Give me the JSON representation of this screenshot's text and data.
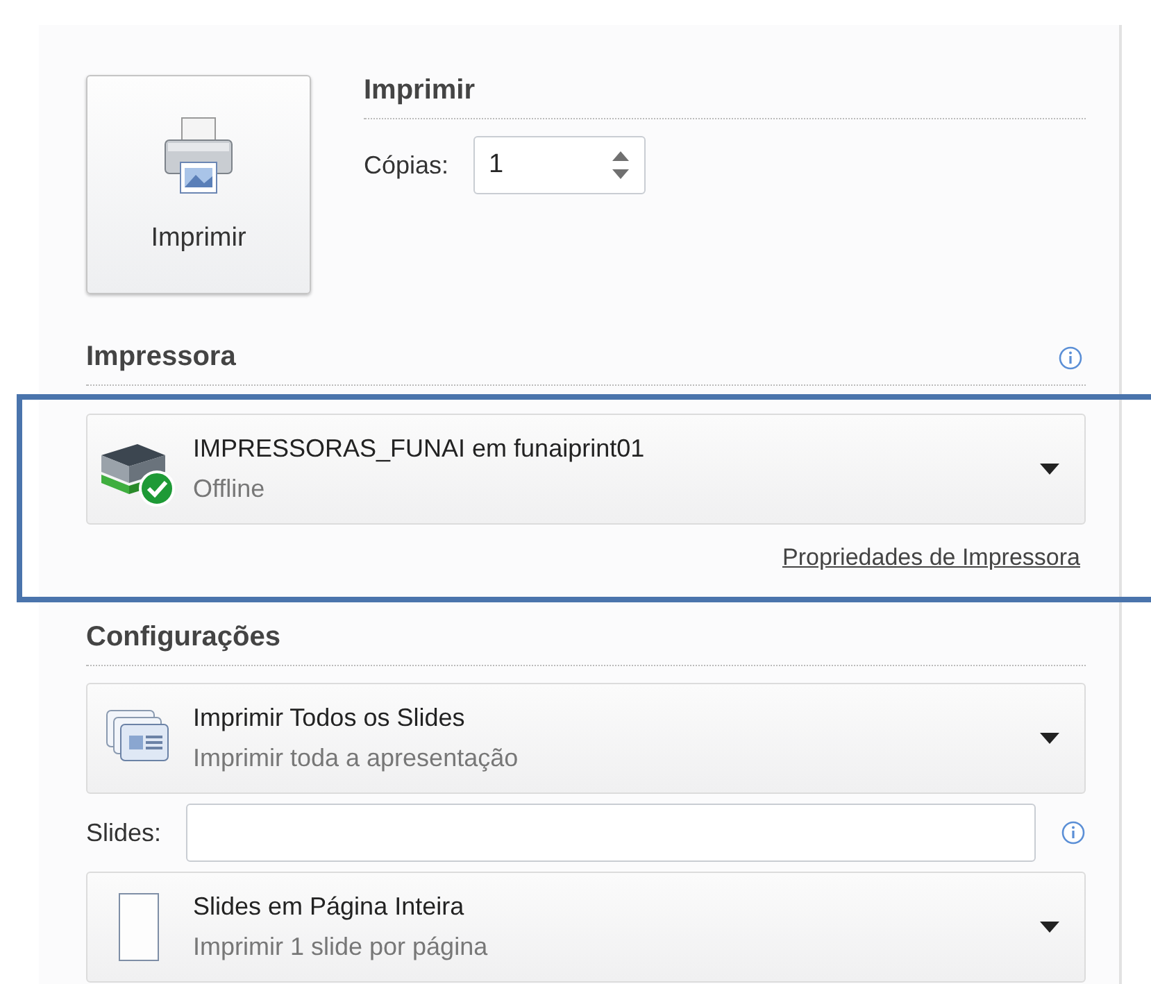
{
  "print_button": {
    "label": "Imprimir"
  },
  "print_section": {
    "title": "Imprimir",
    "copies_label": "Cópias:",
    "copies_value": "1"
  },
  "printer_section": {
    "title": "Impressora",
    "printer": {
      "name": "IMPRESSORAS_FUNAI em funaiprint01",
      "status": "Offline",
      "ready": true
    },
    "properties_link": "Propriedades de Impressora",
    "highlighted": true
  },
  "settings_section": {
    "title": "Configurações",
    "dropdowns": [
      {
        "kind": "slides",
        "title": "Imprimir Todos os Slides",
        "subtitle": "Imprimir toda a apresentação"
      },
      {
        "kind": "page",
        "title": "Slides em Página Inteira",
        "subtitle": "Imprimir 1 slide por página"
      }
    ],
    "slides_label": "Slides:"
  }
}
